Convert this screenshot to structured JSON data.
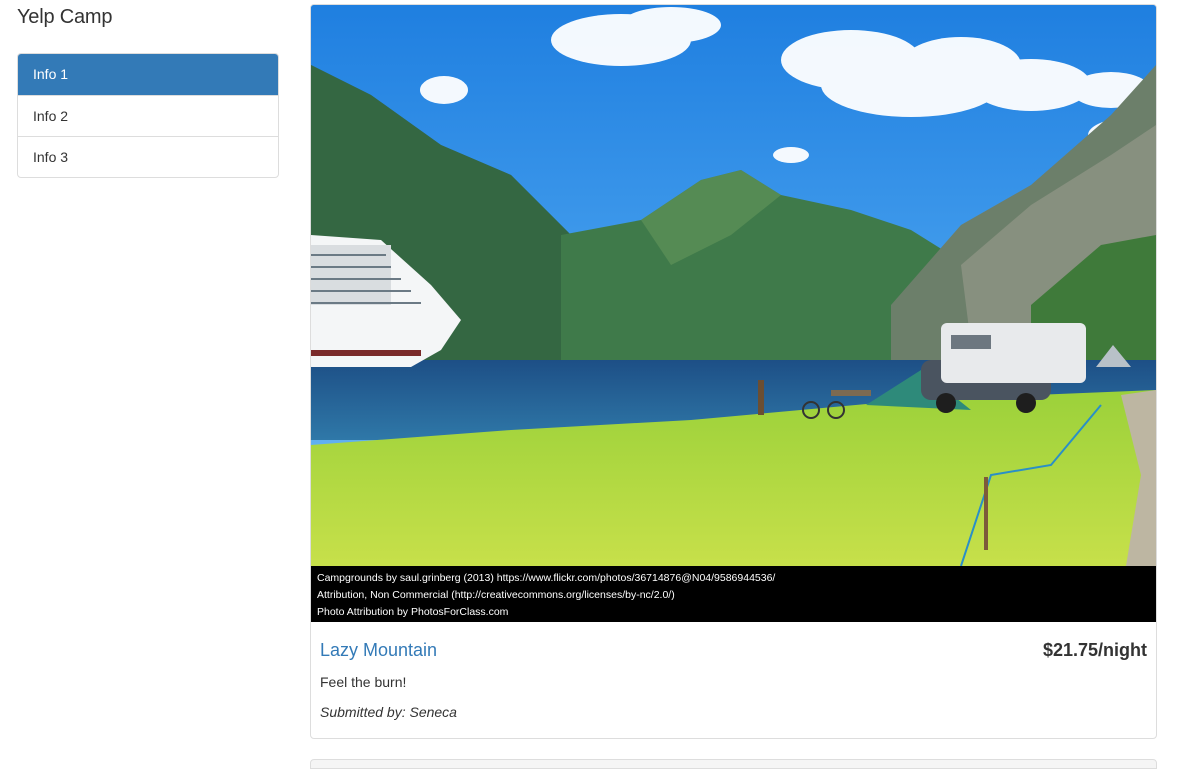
{
  "app": {
    "title": "Yelp Camp"
  },
  "sidebar": {
    "items": [
      {
        "label": "Info 1",
        "active": true
      },
      {
        "label": "Info 2",
        "active": false
      },
      {
        "label": "Info 3",
        "active": false
      }
    ]
  },
  "campground": {
    "image_alt": "campground-photo",
    "attribution": [
      "Campgrounds  by  saul.grinberg  (2013)  https://www.flickr.com/photos/36714876@N04/9586944536/",
      "Attribution, Non Commercial (http://creativecommons.org/licenses/by-nc/2.0/)",
      "Photo Attribution by PhotosForClass.com"
    ],
    "name": "Lazy Mountain",
    "price": "$21.75/night",
    "description": "Feel the burn!",
    "author_prefix": "Submitted by:",
    "author": "Seneca",
    "author_line": "Submitted by: Seneca"
  },
  "colors": {
    "accent": "#337ab7",
    "border": "#dddddd",
    "attribution_bg": "#000000"
  }
}
